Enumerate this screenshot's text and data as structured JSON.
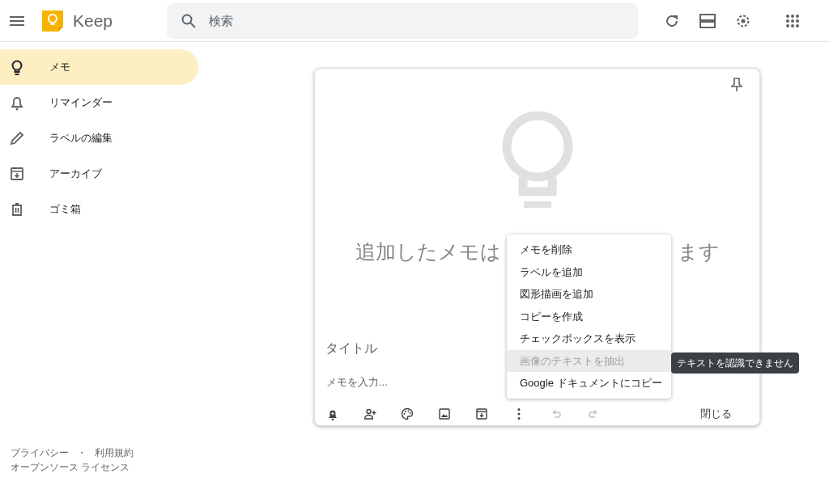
{
  "header": {
    "app_name": "Keep",
    "search": {
      "placeholder": "検索"
    }
  },
  "sidebar": {
    "items": [
      {
        "kind": "bulb",
        "label": "メモ",
        "selected": true
      },
      {
        "kind": "bell",
        "label": "リマインダー",
        "selected": false
      },
      {
        "kind": "pencil",
        "label": "ラベルの編集",
        "selected": false
      },
      {
        "kind": "archive",
        "label": "アーカイブ",
        "selected": false
      },
      {
        "kind": "trash",
        "label": "ゴミ箱",
        "selected": false
      }
    ]
  },
  "footer": {
    "links": [
      "プライバシー",
      "利用規約"
    ],
    "separator": "・",
    "license": "オープンソース ライセンス"
  },
  "note": {
    "empty_message_left": "追加したメモは",
    "empty_message_right": "ます",
    "title": {
      "placeholder": "タイトル"
    },
    "body": {
      "placeholder": "メモを入力..."
    },
    "toolbar": [
      {
        "kind": "reminder",
        "disabled": false
      },
      {
        "kind": "collaborator",
        "disabled": false
      },
      {
        "kind": "palette",
        "disabled": false
      },
      {
        "kind": "image",
        "disabled": false
      },
      {
        "kind": "archive",
        "disabled": false
      },
      {
        "kind": "more",
        "disabled": false
      },
      {
        "kind": "undo",
        "disabled": true
      },
      {
        "kind": "redo",
        "disabled": true
      }
    ],
    "close_button": "閉じる"
  },
  "menu": {
    "items": [
      {
        "label": "メモを削除",
        "disabled": false,
        "highlighted": false
      },
      {
        "label": "ラベルを追加",
        "disabled": false,
        "highlighted": false
      },
      {
        "label": "図形描画を追加",
        "disabled": false,
        "highlighted": false
      },
      {
        "label": "コピーを作成",
        "disabled": false,
        "highlighted": false
      },
      {
        "label": "チェックボックスを表示",
        "disabled": false,
        "highlighted": false
      },
      {
        "label": "画像のテキストを抽出",
        "disabled": true,
        "highlighted": true
      },
      {
        "label": "Google ドキュメントにコピー",
        "disabled": false,
        "highlighted": false
      }
    ]
  },
  "tooltip": "テキストを認識できません"
}
